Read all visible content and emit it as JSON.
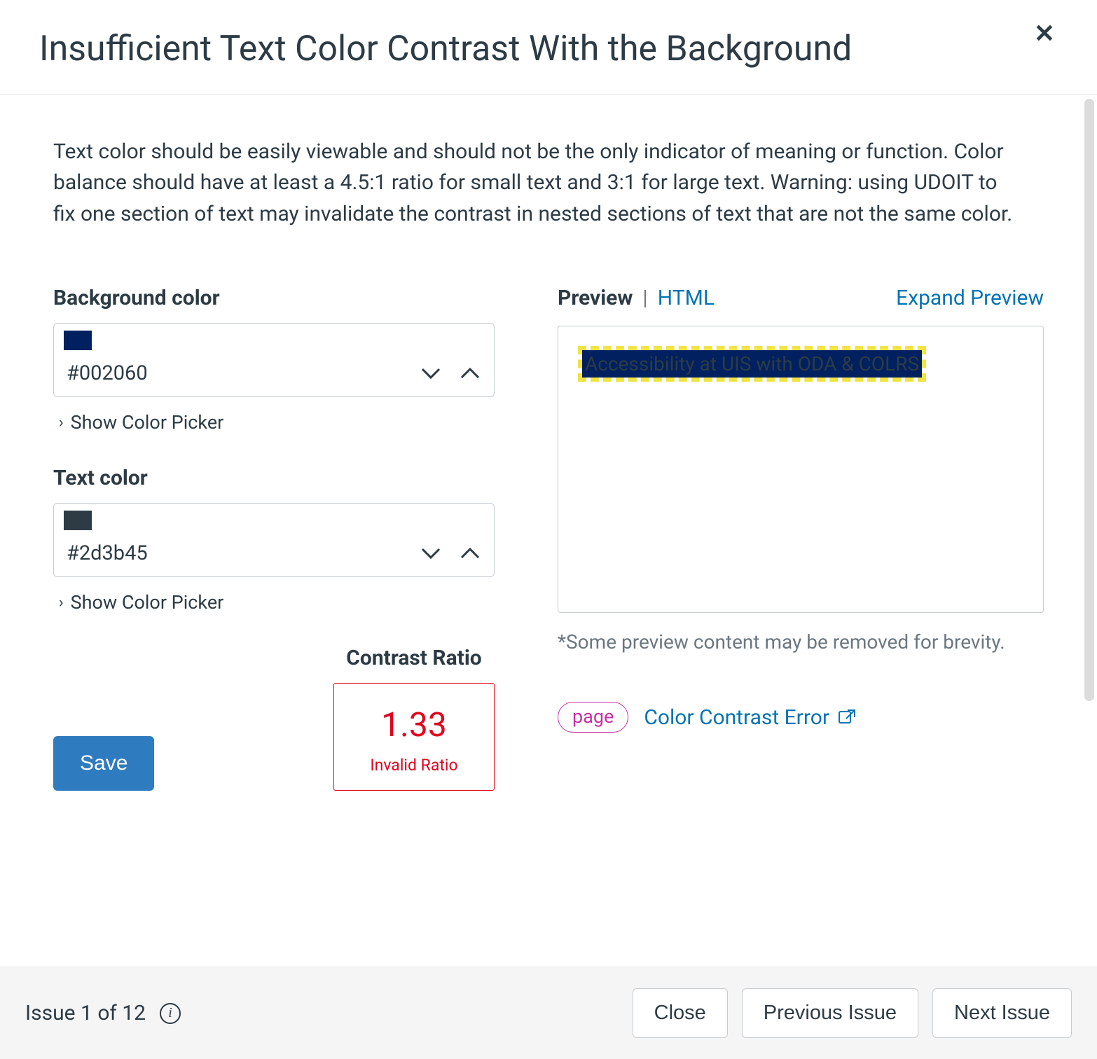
{
  "header": {
    "title": "Insufficient Text Color Contrast With the Background"
  },
  "description": "Text color should be easily viewable and should not be the only indicator of meaning or function. Color balance should have at least a 4.5:1 ratio for small text and 3:1 for large text. Warning: using UDOIT to fix one section of text may invalidate the contrast in nested sections of text that are not the same color.",
  "fields": {
    "background": {
      "label": "Background color",
      "value": "#002060",
      "swatch": "#002060",
      "picker_toggle": "Show Color Picker"
    },
    "text": {
      "label": "Text color",
      "value": "#2d3b45",
      "swatch": "#2d3b45",
      "picker_toggle": "Show Color Picker"
    }
  },
  "contrast": {
    "label": "Contrast Ratio",
    "value": "1.33",
    "status": "Invalid Ratio"
  },
  "actions": {
    "save": "Save"
  },
  "preview": {
    "tab_preview": "Preview",
    "tab_html": "HTML",
    "expand": "Expand Preview",
    "sample_text": "Accessibility at UIS with ODA & COLRS",
    "note": "*Some preview content may be removed for brevity."
  },
  "tags": {
    "page_pill": "page",
    "error_link": "Color Contrast Error"
  },
  "footer": {
    "issue_counter": "Issue 1 of 12",
    "close": "Close",
    "previous": "Previous Issue",
    "next": "Next Issue"
  }
}
